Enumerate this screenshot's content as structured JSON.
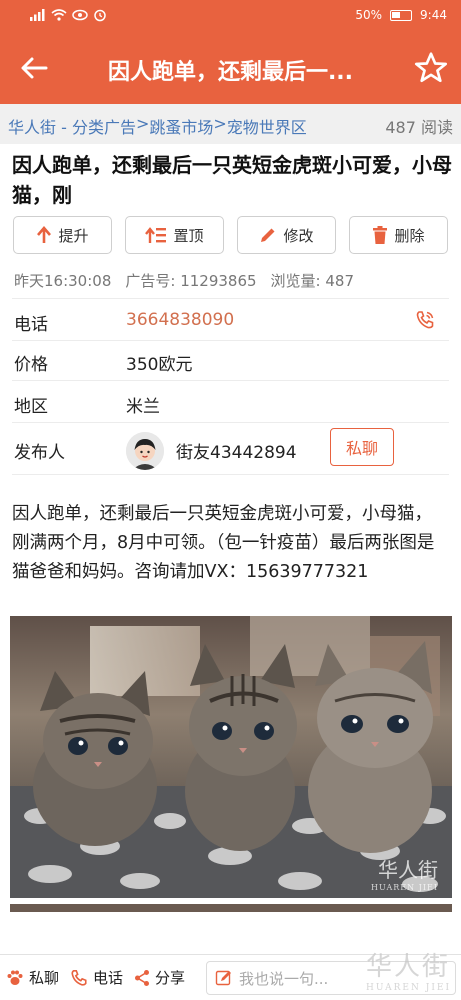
{
  "status_bar": {
    "battery": "50%",
    "time": "9:44"
  },
  "header": {
    "title": "因人跑单，还剩最后一...",
    "back_icon": "arrow-left-icon",
    "favorite_icon": "star-outline-icon"
  },
  "breadcrumb": {
    "items": [
      "华人街 - 分类广告",
      "跳蚤市场",
      "宠物世界区"
    ],
    "separator": ">",
    "read_count": "487 阅读"
  },
  "post": {
    "title": "因人跑单，还剩最后一只英短金虎斑小可爱，小母猫，刚",
    "actions": [
      {
        "label": "提升",
        "icon": "arrow-up-icon"
      },
      {
        "label": "置顶",
        "icon": "pin-top-icon"
      },
      {
        "label": "修改",
        "icon": "pencil-icon"
      },
      {
        "label": "删除",
        "icon": "trash-icon"
      }
    ],
    "posted_time": "昨天16:30:08",
    "ad_number": "广告号: 11293865",
    "views": "浏览量: 487",
    "fields": {
      "phone_label": "电话",
      "phone_value": "3664838090",
      "price_label": "价格",
      "price_value": "350欧元",
      "region_label": "地区",
      "region_value": "米兰",
      "poster_label": "发布人",
      "poster_value": "街友43442894",
      "pm_button": "私聊"
    },
    "description": "因人跑单，还剩最后一只英短金虎斑小可爱，小母猫，刚满两个月，8月中可领。（包一针疫苗）最后两张图是猫爸爸和妈妈。咨询请加VX：15639777321",
    "photo_watermark": "华人街",
    "photo_watermark_sub": "HUAREN JIEI"
  },
  "bottom_bar": {
    "pm": "私聊",
    "phone": "电话",
    "share": "分享",
    "comment_placeholder": "我也说一句...",
    "watermark": "华人街",
    "watermark_sub": "HUAREN JIEI"
  },
  "colors": {
    "accent": "#e8623f",
    "link": "#4a79b8"
  }
}
